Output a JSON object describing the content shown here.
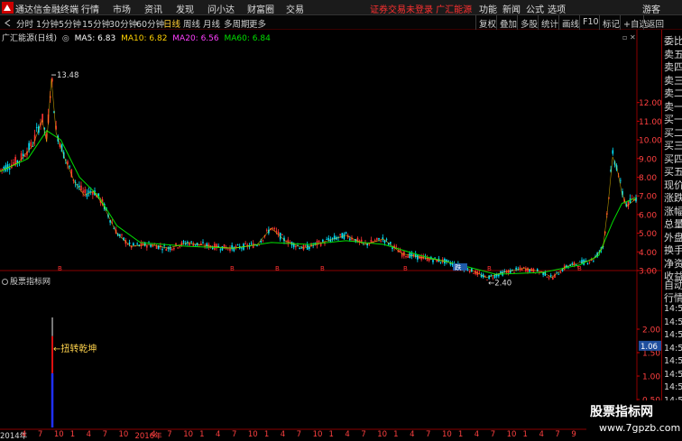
{
  "app": {
    "title": "通达信金融终端"
  },
  "menu": [
    "行情",
    "市场",
    "资讯",
    "发现",
    "问小达",
    "财富圈",
    "交易"
  ],
  "alert": "证券交易未登录  广汇能源",
  "right_menu": [
    "功能",
    "新闻",
    "公式",
    "选项",
    "游客"
  ],
  "periods": [
    "分时",
    "1分钟",
    "5分钟",
    "15分钟",
    "30分钟",
    "60分钟",
    "日线",
    "周线",
    "月线",
    "多周期",
    "更多"
  ],
  "active_period": "日线",
  "tools": [
    "复权",
    "叠加",
    "多股",
    "统计",
    "画线",
    "F10",
    "标记",
    "+自选",
    "返回"
  ],
  "indicators": {
    "stock_name": "广汇能源(日线)",
    "ma5": "MA5: 6.83",
    "ma10": "MA10: 6.82",
    "ma20": "MA20: 6.56",
    "ma60": "MA60: 6.84"
  },
  "colors": {
    "ma5": "#ffffff",
    "ma10": "#ffd200",
    "ma20": "#ff40ff",
    "ma60": "#00e000",
    "up": "#ff3232",
    "down": "#00e5ff",
    "axis": "#8a0000"
  },
  "price_axis": [
    "12.00",
    "11.00",
    "10.00",
    "9.00",
    "8.00",
    "7.00",
    "6.00",
    "5.00",
    "4.00",
    "3.00"
  ],
  "high_label": "13.48",
  "low_label": "2.40",
  "event_markers": [
    "B",
    "B",
    "B",
    "B",
    "B",
    "B",
    "B"
  ],
  "badge_label": "跌",
  "sub_panel": {
    "title": "股票指标网",
    "axis": [
      "2.00",
      "1.50",
      "1.00",
      "0.50"
    ],
    "current_value": "1.06",
    "annotation": "←扭转乾坤"
  },
  "right_panel": {
    "labels": [
      "委比",
      "卖五",
      "卖四",
      "卖三",
      "卖二",
      "卖一",
      "买一",
      "买二",
      "买三",
      "买四",
      "买五",
      "现价",
      "涨跌",
      "涨幅",
      "总量",
      "外盘",
      "换手",
      "净资",
      "收益"
    ],
    "labels2": [
      "自动",
      "行情"
    ],
    "times": [
      "14:56",
      "14:56",
      "14:56",
      "14:56",
      "14:56",
      "14:56",
      "14:56",
      "14:56",
      "14:56"
    ]
  },
  "time_axis": [
    "2014年",
    "4",
    "7",
    "10",
    "1",
    "4",
    "7",
    "10",
    "2016年",
    "4",
    "7",
    "10",
    "1",
    "4",
    "7",
    "10",
    "1",
    "4",
    "7",
    "10",
    "1",
    "4",
    "7",
    "10",
    "1",
    "4",
    "7",
    "10",
    "1",
    "4",
    "7",
    "10",
    "1",
    "4",
    "7",
    "9",
    "12",
    "2",
    "5"
  ],
  "watermark": {
    "line1": "股票指标网",
    "line2": "www.7gpzb.com"
  },
  "chart_data": {
    "type": "line",
    "title": "广汇能源(日线)",
    "xlabel": "",
    "ylabel": "",
    "ylim": [
      2.4,
      13.48
    ],
    "description_points": [
      {
        "t": 0,
        "v": 8.4
      },
      {
        "t": 4,
        "v": 8.9
      },
      {
        "t": 7,
        "v": 9.8
      },
      {
        "t": 9,
        "v": 11.2
      },
      {
        "t": 10,
        "v": 10.0
      },
      {
        "t": 11,
        "v": 13.48
      },
      {
        "t": 12,
        "v": 10.5
      },
      {
        "t": 14,
        "v": 9.0
      },
      {
        "t": 16,
        "v": 7.8
      },
      {
        "t": 18,
        "v": 7.1
      },
      {
        "t": 20,
        "v": 7.3
      },
      {
        "t": 22,
        "v": 6.6
      },
      {
        "t": 25,
        "v": 5.0
      },
      {
        "t": 28,
        "v": 4.3
      },
      {
        "t": 32,
        "v": 4.4
      },
      {
        "t": 36,
        "v": 4.2
      },
      {
        "t": 40,
        "v": 4.5
      },
      {
        "t": 45,
        "v": 4.3
      },
      {
        "t": 50,
        "v": 4.2
      },
      {
        "t": 55,
        "v": 4.4
      },
      {
        "t": 58,
        "v": 5.3
      },
      {
        "t": 61,
        "v": 4.6
      },
      {
        "t": 65,
        "v": 4.2
      },
      {
        "t": 70,
        "v": 4.6
      },
      {
        "t": 74,
        "v": 4.9
      },
      {
        "t": 78,
        "v": 4.4
      },
      {
        "t": 82,
        "v": 4.7
      },
      {
        "t": 86,
        "v": 3.9
      },
      {
        "t": 90,
        "v": 3.7
      },
      {
        "t": 95,
        "v": 3.5
      },
      {
        "t": 100,
        "v": 3.1
      },
      {
        "t": 104,
        "v": 2.6
      },
      {
        "t": 108,
        "v": 2.9
      },
      {
        "t": 112,
        "v": 3.1
      },
      {
        "t": 116,
        "v": 2.9
      },
      {
        "t": 118,
        "v": 2.6
      },
      {
        "t": 121,
        "v": 3.2
      },
      {
        "t": 124,
        "v": 3.4
      },
      {
        "t": 127,
        "v": 3.6
      },
      {
        "t": 129,
        "v": 4.3
      },
      {
        "t": 130,
        "v": 6.5
      },
      {
        "t": 131,
        "v": 9.2
      },
      {
        "t": 132,
        "v": 8.5
      },
      {
        "t": 133,
        "v": 7.2
      },
      {
        "t": 134,
        "v": 6.5
      },
      {
        "t": 136,
        "v": 6.9
      }
    ],
    "ma": [
      {
        "t": 0,
        "v": 8.3
      },
      {
        "t": 6,
        "v": 9.0
      },
      {
        "t": 10,
        "v": 10.5
      },
      {
        "t": 13,
        "v": 10.0
      },
      {
        "t": 17,
        "v": 8.0
      },
      {
        "t": 21,
        "v": 7.0
      },
      {
        "t": 25,
        "v": 5.4
      },
      {
        "t": 30,
        "v": 4.5
      },
      {
        "t": 40,
        "v": 4.3
      },
      {
        "t": 50,
        "v": 4.2
      },
      {
        "t": 58,
        "v": 4.5
      },
      {
        "t": 66,
        "v": 4.4
      },
      {
        "t": 74,
        "v": 4.6
      },
      {
        "t": 82,
        "v": 4.4
      },
      {
        "t": 90,
        "v": 3.8
      },
      {
        "t": 100,
        "v": 3.2
      },
      {
        "t": 106,
        "v": 2.8
      },
      {
        "t": 116,
        "v": 2.9
      },
      {
        "t": 124,
        "v": 3.3
      },
      {
        "t": 128,
        "v": 3.8
      },
      {
        "t": 131,
        "v": 5.6
      },
      {
        "t": 133,
        "v": 6.6
      },
      {
        "t": 136,
        "v": 6.9
      }
    ],
    "sub_signal": {
      "t": 11,
      "value": 1.06,
      "red_top": 1.85,
      "blue_bottom": 0.0,
      "white_top": 2.25
    }
  }
}
